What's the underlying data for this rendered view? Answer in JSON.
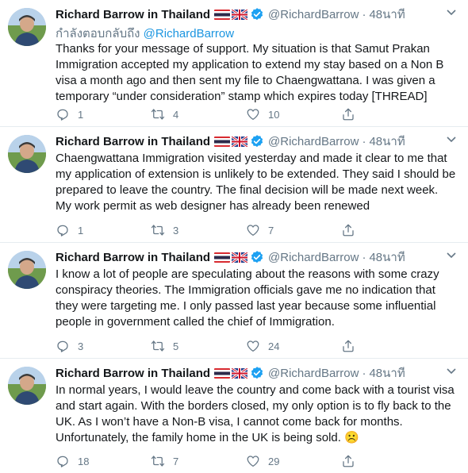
{
  "tweets": [
    {
      "name": "Richard Barrow in Thailand",
      "handle": "@RichardBarrow",
      "time": "48นาที",
      "reply_prefix": "กำลังตอบกลับถึง",
      "reply_mention": "@RichardBarrow",
      "text": "Thanks for your message of support. My situation is that Samut Prakan Immigration accepted my application to extend my stay based on a Non B visa a month ago and then sent my file to Chaengwattana. I was given a temporary “under consideration” stamp which expires today [THREAD]",
      "replies": "1",
      "retweets": "4",
      "likes": "10"
    },
    {
      "name": "Richard Barrow in Thailand",
      "handle": "@RichardBarrow",
      "time": "48นาที",
      "text": "Chaengwattana Immigration visited yesterday and made it clear to me that my application of extension is unlikely to be extended. They said I should be prepared to leave the country. The final decision will be made next week. My work permit as web designer has already been renewed",
      "replies": "1",
      "retweets": "3",
      "likes": "7"
    },
    {
      "name": "Richard Barrow in Thailand",
      "handle": "@RichardBarrow",
      "time": "48นาที",
      "text": "I know a lot of people are speculating about the reasons with some crazy conspiracy theories. The Immigration officials gave me no indication that they were targeting me. I only passed last year because some influential people in government called the chief of Immigration.",
      "replies": "3",
      "retweets": "5",
      "likes": "24"
    },
    {
      "name": "Richard Barrow in Thailand",
      "handle": "@RichardBarrow",
      "time": "48นาที",
      "text": "In normal years, I would leave the country and come back with a tourist visa and start again. With the borders closed, my only option is to fly back to the UK. As I won’t have a Non-B visa, I cannot come back for months. Unfortunately, the family home in the UK is being sold. ☹️",
      "replies": "18",
      "retweets": "7",
      "likes": "29"
    }
  ],
  "colors": {
    "text": "#14171a",
    "secondary": "#657786",
    "link": "#1b95e0",
    "verified": "#1da1f2",
    "divider": "#e6ecf0"
  }
}
